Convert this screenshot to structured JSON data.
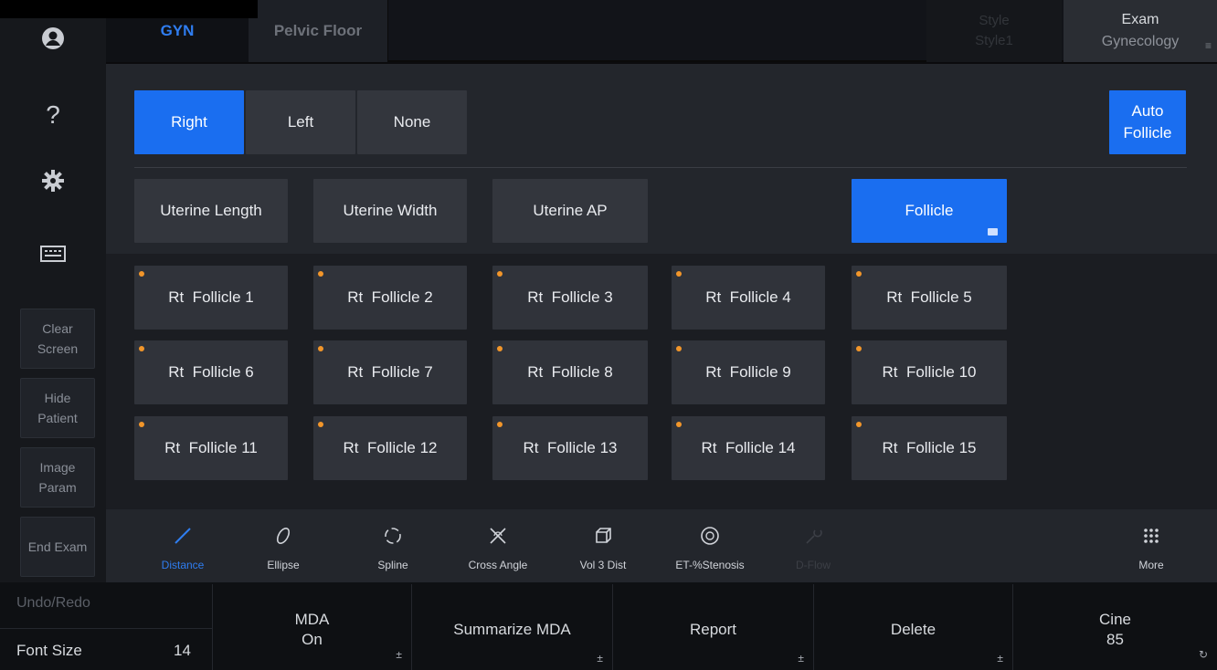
{
  "tabs": [
    {
      "label": "GYN"
    },
    {
      "label": "Pelvic Floor"
    }
  ],
  "style_btn": {
    "line1": "Style",
    "line2": "Style1"
  },
  "exam_btn": {
    "line1": "Exam",
    "line2": "Gynecology"
  },
  "sidebar": {
    "icons": [
      "user-icon",
      "help-icon",
      "settings-icon",
      "keyboard-icon"
    ],
    "help_glyph": "?",
    "buttons": [
      {
        "label": "Clear\nScreen"
      },
      {
        "label": "Hide\nPatient"
      },
      {
        "label": "Image\nParam"
      },
      {
        "label": "End Exam"
      }
    ]
  },
  "side_select": {
    "options": [
      "Right",
      "Left",
      "None"
    ],
    "selected": "Right"
  },
  "auto_follicle": "Auto\nFollicle",
  "measure_buttons": [
    {
      "label": "Uterine Length"
    },
    {
      "label": "Uterine Width"
    },
    {
      "label": "Uterine AP"
    },
    {
      "label": "Follicle"
    }
  ],
  "follicles": [
    "Rt  Follicle 1",
    "Rt  Follicle 2",
    "Rt  Follicle 3",
    "Rt  Follicle 4",
    "Rt  Follicle 5",
    "Rt  Follicle 6",
    "Rt  Follicle 7",
    "Rt  Follicle 8",
    "Rt  Follicle 9",
    "Rt  Follicle 10",
    "Rt  Follicle 11",
    "Rt  Follicle 12",
    "Rt  Follicle 13",
    "Rt  Follicle 14",
    "Rt  Follicle 15"
  ],
  "tools": [
    {
      "label": "Distance",
      "icon": "distance-icon"
    },
    {
      "label": "Ellipse",
      "icon": "ellipse-icon"
    },
    {
      "label": "Spline",
      "icon": "spline-icon"
    },
    {
      "label": "Cross Angle",
      "icon": "cross-angle-icon"
    },
    {
      "label": "Vol 3 Dist",
      "icon": "volume-icon"
    },
    {
      "label": "ET-%Stenosis",
      "icon": "stenosis-icon"
    },
    {
      "label": "D-Flow",
      "icon": "dflow-icon"
    },
    {
      "label": "More",
      "icon": "more-grid-icon"
    }
  ],
  "bottom": {
    "undo": "Undo/Redo",
    "font_size_label": "Font Size",
    "font_size_value": "14",
    "mda": {
      "line1": "MDA",
      "line2": "On"
    },
    "summarize": "Summarize MDA",
    "report": "Report",
    "delete": "Delete",
    "cine": {
      "line1": "Cine",
      "line2": "85"
    },
    "arrow_glyph": "±"
  },
  "colors": {
    "accent": "#1a6ef0",
    "marker": "#f2962a",
    "tab_active": "#2f7df0"
  }
}
